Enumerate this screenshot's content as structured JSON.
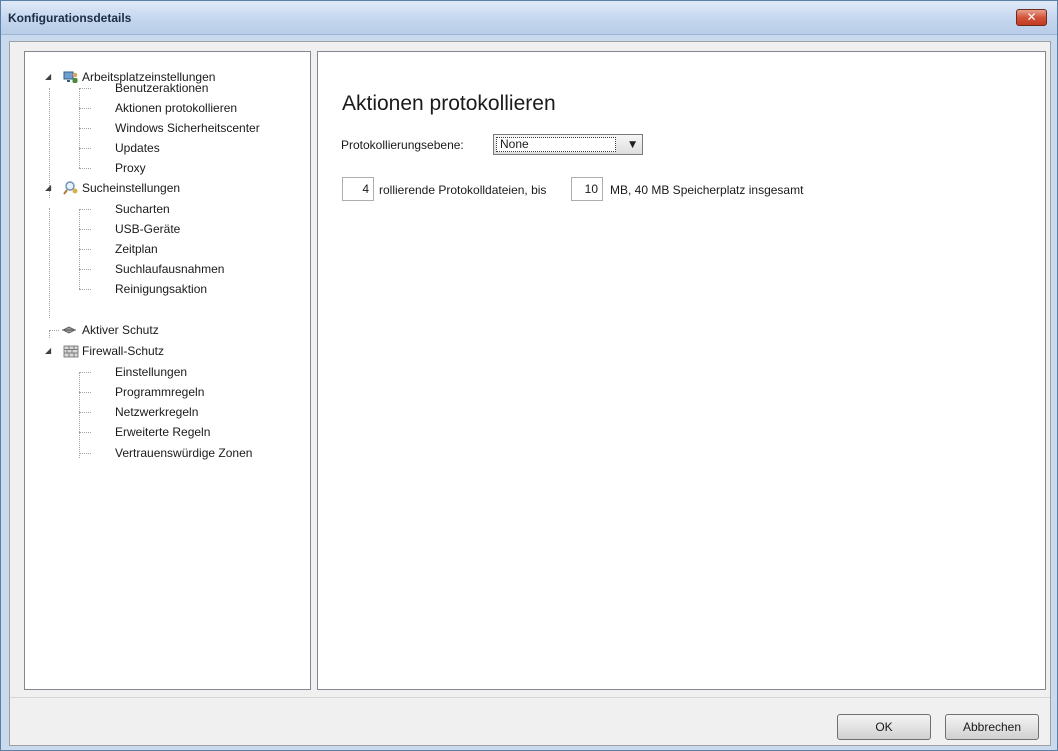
{
  "window": {
    "title": "Konfigurationsdetails",
    "close_label": "✕"
  },
  "tree": {
    "groups": [
      {
        "label": "Arbeitsplatzeinstellungen",
        "icon": "computer-user-icon",
        "items": [
          "Benutzeraktionen",
          "Aktionen protokollieren",
          "Windows Sicherheitscenter",
          "Updates",
          "Proxy"
        ]
      },
      {
        "label": "Sucheinstellungen",
        "icon": "magnifier-icon",
        "items": [
          "Sucharten",
          "USB-Geräte",
          "Zeitplan",
          "Suchlaufausnahmen",
          "Reinigungsaktion"
        ]
      },
      {
        "label": "Aktiver Schutz",
        "icon": "shield-icon",
        "items": []
      },
      {
        "label": "Firewall-Schutz",
        "icon": "firewall-icon",
        "items": [
          "Einstellungen",
          "Programmregeln",
          "Netzwerkregeln",
          "Erweiterte Regeln",
          "Vertrauenswürdige Zonen"
        ]
      }
    ]
  },
  "content": {
    "title": "Aktionen protokollieren",
    "log_level_label": "Protokollierungsebene:",
    "log_level_value": "None",
    "rolling_count": "4",
    "rolling_text": "rollierende Protokolldateien, bis",
    "size_limit": "10",
    "size_text": "MB, 40 MB Speicherplatz insgesamt"
  },
  "footer": {
    "ok_label": "OK",
    "cancel_label": "Abbrechen"
  },
  "colors": {
    "title_bar": "#c4d6ee",
    "close_button": "#d2533a",
    "client_background": "#f0f0f0"
  }
}
